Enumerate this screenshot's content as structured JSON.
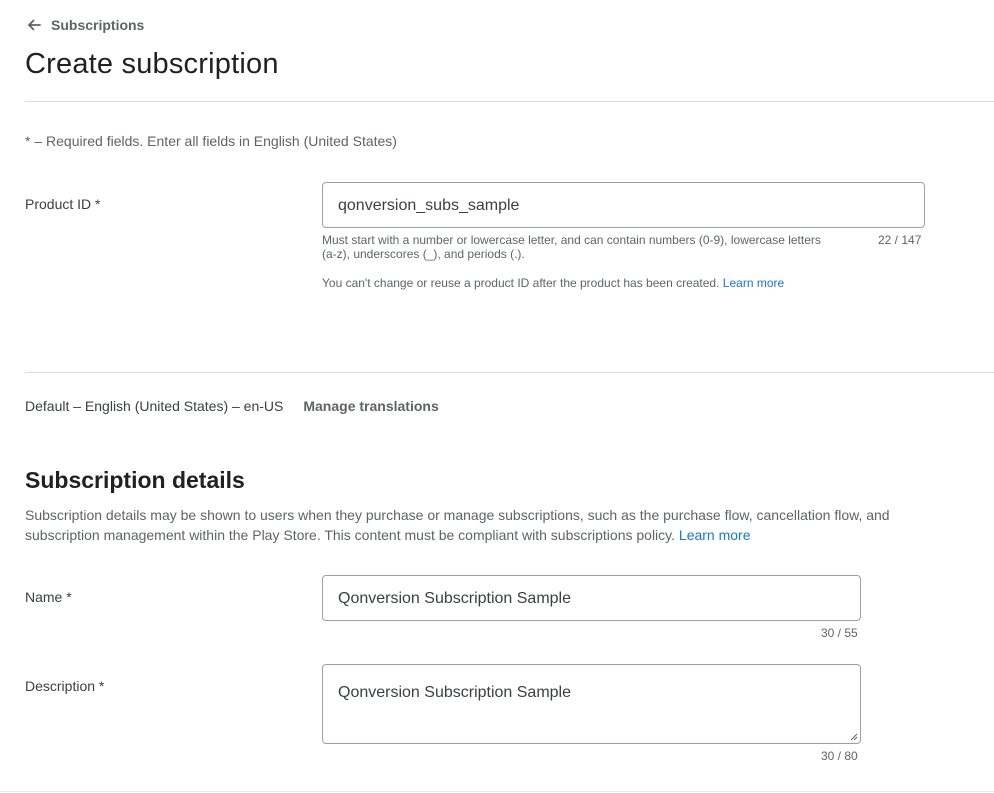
{
  "header": {
    "back_label": "Subscriptions",
    "title": "Create subscription"
  },
  "required_note": "* – Required fields. Enter all fields in English (United States)",
  "product_id": {
    "label": "Product ID  *",
    "value": "qonversion_subs_sample",
    "hint_line1": "Must start with a number or lowercase letter, and can contain numbers (0-9), lowercase letters",
    "hint_line2": "(a-z), underscores (_), and periods (.).",
    "counter": "22 / 147",
    "note": "You can't change or reuse a product ID after the product has been created.",
    "learn_more": "Learn more"
  },
  "language": {
    "default_label": "Default – English (United States) – en-US",
    "manage_translations": "Manage translations"
  },
  "subscription_details": {
    "title": "Subscription details",
    "desc_line1": "Subscription details may be shown to users when they purchase or manage subscriptions, such as the purchase flow, cancellation flow, and",
    "desc_line2": "subscription management within the Play Store. This content must be compliant with subscriptions policy.",
    "learn_more": "Learn more",
    "name": {
      "label": "Name  *",
      "value": "Qonversion Subscription Sample",
      "counter": "30 / 55"
    },
    "description": {
      "label": "Description  *",
      "value": "Qonversion Subscription Sample",
      "counter": "30 / 80"
    }
  },
  "icons": {
    "back": "arrow-left-icon",
    "resize": "resize-grip-icon"
  },
  "colors": {
    "link": "#1a73e8",
    "text": "#202124",
    "muted": "#5f6368",
    "border": "#9aa0a6"
  }
}
